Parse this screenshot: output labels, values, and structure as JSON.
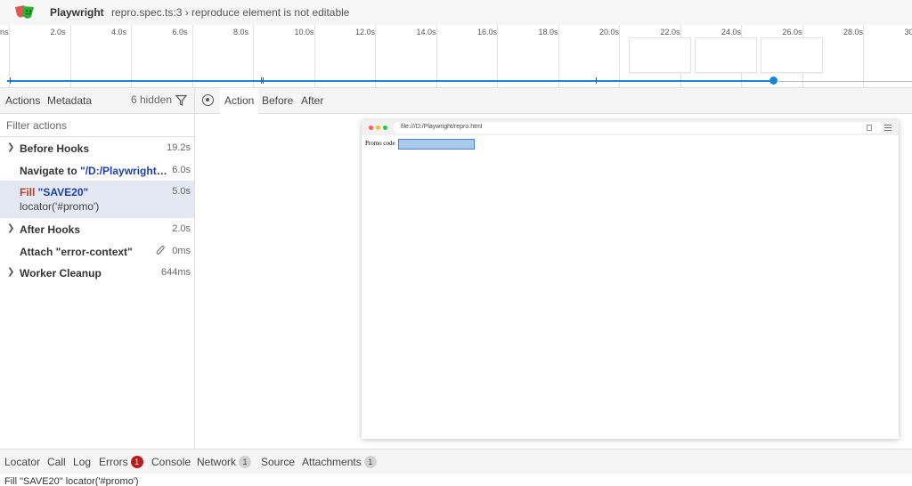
{
  "header": {
    "app_title": "Playwright",
    "subtitle": "repro.spec.ts:3 › reproduce element is not editable"
  },
  "timeline": {
    "ticks": [
      "ns",
      "2.0s",
      "4.0s",
      "6.0s",
      "8.0s",
      "10.0s",
      "12.0s",
      "14.0s",
      "16.0s",
      "18.0s",
      "20.0s",
      "22.0s",
      "24.0s",
      "26.0s",
      "28.0s",
      "30"
    ],
    "progress_fraction": 0.846,
    "track_color": "#1a86d1"
  },
  "left_tabs": {
    "actions": "Actions",
    "metadata": "Metadata",
    "hidden": "6 hidden"
  },
  "filter": {
    "placeholder": "Filter actions"
  },
  "actions": [
    {
      "expandable": true,
      "title": "Before Hooks",
      "time": "19.2s"
    },
    {
      "expandable": false,
      "title_prefix": "Navigate to ",
      "title_str": "\"/D:/Playwright/re...",
      "time": "6.0s"
    },
    {
      "expandable": false,
      "title_prefix": "Fill ",
      "title_str": "\"SAVE20\"",
      "sub": "locator('#promo')",
      "time": "5.0s",
      "selected": true
    },
    {
      "expandable": true,
      "title": "After Hooks",
      "time": "2.0s"
    },
    {
      "expandable": false,
      "title": "Attach \"error-context\"",
      "time": "0ms",
      "attachment": true
    },
    {
      "expandable": true,
      "title": "Worker Cleanup",
      "time": "644ms"
    }
  ],
  "right_tabs": {
    "action": "Action",
    "before": "Before",
    "after": "After"
  },
  "snapshot": {
    "url": "file:///D:/Playwright/repro.html",
    "promo_label": "Promo code"
  },
  "bottom_tabs": {
    "locator": "Locator",
    "call": "Call",
    "log": "Log",
    "errors": "Errors",
    "errors_count": "1",
    "console": "Console",
    "network": "Network",
    "network_count": "1",
    "source": "Source",
    "attachments": "Attachments",
    "attachments_count": "1"
  },
  "bottom_text": "Fill \"SAVE20\" locator('#promo')"
}
